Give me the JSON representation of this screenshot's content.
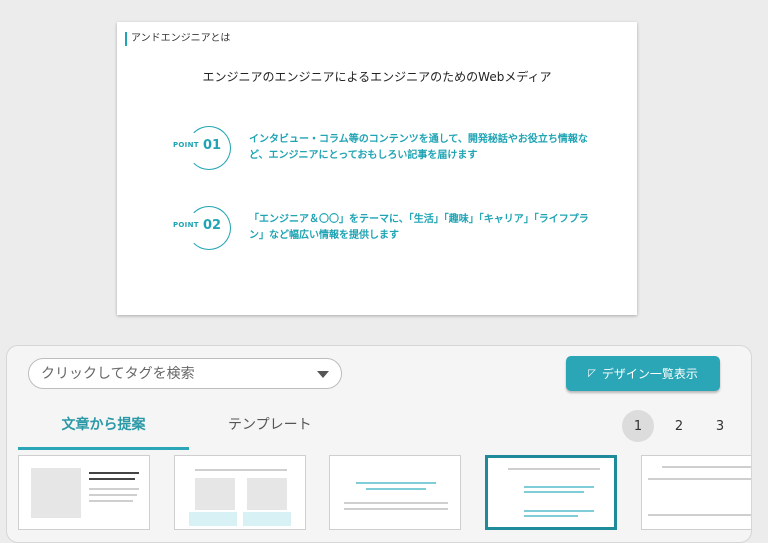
{
  "slide": {
    "label": "アンドエンジニアとは",
    "title": "エンジニアのエンジニアによるエンジニアのためのWebメディア",
    "points": [
      {
        "word": "POINT",
        "num": "01",
        "text": "インタビュー・コラム等のコンテンツを通して、開発秘話やお役立ち情報など、エンジニアにとっておもしろい記事を届けます"
      },
      {
        "word": "POINT",
        "num": "02",
        "text": "「エンジニア＆〇〇」をテーマに、「生活」「趣味」「キャリア」「ライフプラン」など幅広い情報を提供します"
      }
    ]
  },
  "panel": {
    "search_placeholder": "クリックしてタグを検索",
    "design_button_label": "デザイン一覧表示",
    "tabs": [
      {
        "label": "文章から提案",
        "active": true
      },
      {
        "label": "テンプレート",
        "active": false
      }
    ],
    "pages": [
      "1",
      "2",
      "3"
    ],
    "current_page": "1"
  },
  "colors": {
    "accent": "#2ba6b6",
    "tab_active": "#2a98a6"
  },
  "icons": [
    "chevron-down-icon",
    "pencil-icon"
  ]
}
